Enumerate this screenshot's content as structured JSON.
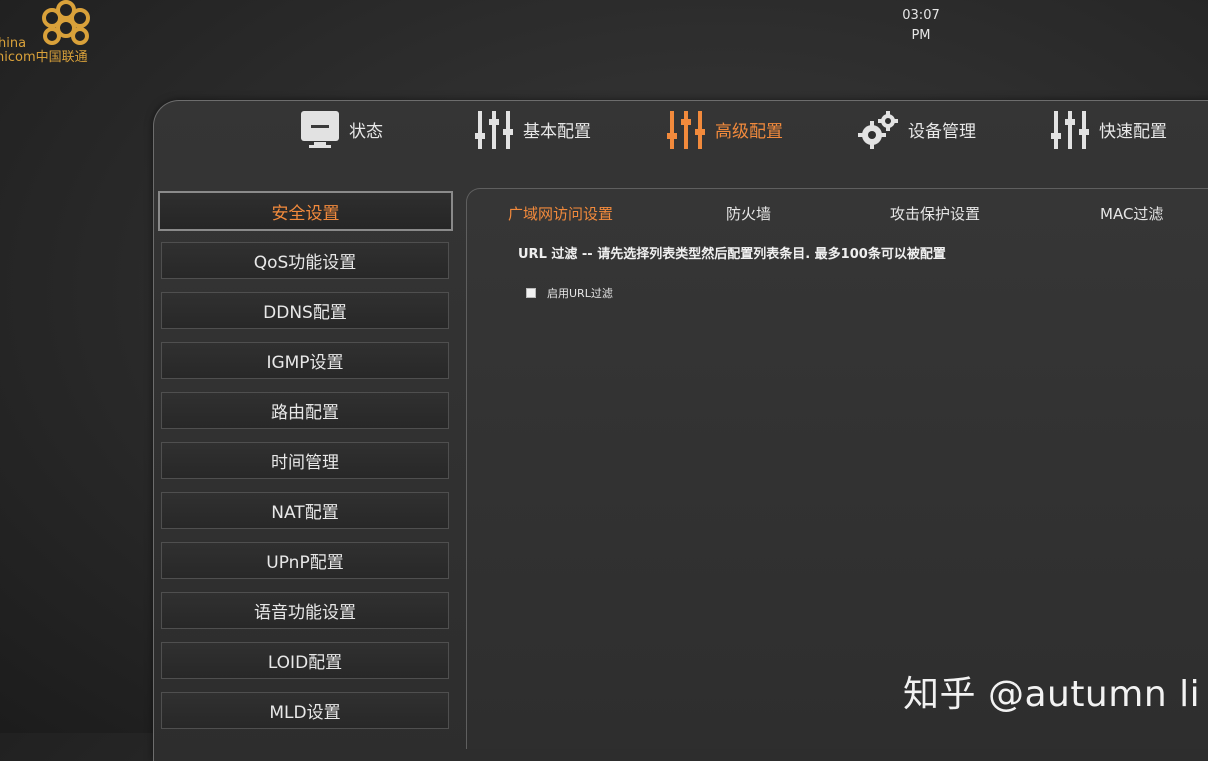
{
  "brand": {
    "logo_text_line1": "hina",
    "logo_text_line2": "nicom中国联通",
    "logo_icon": "china-unicom-knot-icon"
  },
  "clock": {
    "time": "03:07",
    "ampm": "PM"
  },
  "topnav": [
    {
      "label": "状态",
      "icon": "monitor-icon",
      "active": false
    },
    {
      "label": "基本配置",
      "icon": "sliders-icon",
      "active": false
    },
    {
      "label": "高级配置",
      "icon": "sliders-icon",
      "active": true
    },
    {
      "label": "设备管理",
      "icon": "gears-icon",
      "active": false
    },
    {
      "label": "快速配置",
      "icon": "sliders-icon",
      "active": false
    }
  ],
  "sidebar": [
    {
      "label": "安全设置",
      "active": true
    },
    {
      "label": "QoS功能设置"
    },
    {
      "label": "DDNS配置"
    },
    {
      "label": "IGMP设置"
    },
    {
      "label": "路由配置"
    },
    {
      "label": "时间管理"
    },
    {
      "label": "NAT配置"
    },
    {
      "label": "UPnP配置"
    },
    {
      "label": "语音功能设置"
    },
    {
      "label": "LOID配置"
    },
    {
      "label": "MLD设置"
    }
  ],
  "tabs": [
    {
      "label": "广域网访问设置",
      "active": true
    },
    {
      "label": "防火墙"
    },
    {
      "label": "攻击保护设置"
    },
    {
      "label": "MAC过滤"
    }
  ],
  "main": {
    "description": "URL 过滤 -- 请先选择列表类型然后配置列表条目. 最多100条可以被配置",
    "enable_url_filter_label": "启用URL过滤",
    "enable_url_filter_checked": false
  },
  "watermark": "知乎 @autumn li",
  "colors": {
    "accent": "#f28a3c",
    "brand_gold": "#d9a13a",
    "background": "#2a2a2a"
  }
}
